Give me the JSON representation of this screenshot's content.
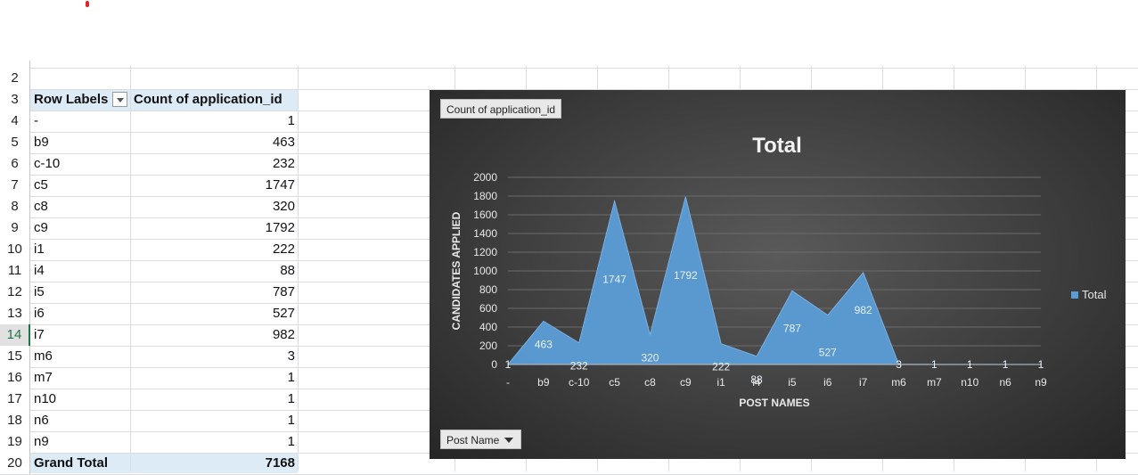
{
  "pivot": {
    "header_row_labels": "Row Labels",
    "header_count": "Count of application_id",
    "rows": [
      {
        "label": "-",
        "value": "1"
      },
      {
        "label": "b9",
        "value": "463"
      },
      {
        "label": "c-10",
        "value": "232"
      },
      {
        "label": "c5",
        "value": "1747"
      },
      {
        "label": "c8",
        "value": "320"
      },
      {
        "label": "c9",
        "value": "1792"
      },
      {
        "label": "i1",
        "value": "222"
      },
      {
        "label": "i4",
        "value": "88"
      },
      {
        "label": "i5",
        "value": "787"
      },
      {
        "label": "i6",
        "value": "527"
      },
      {
        "label": "i7",
        "value": "982"
      },
      {
        "label": "m6",
        "value": "3"
      },
      {
        "label": "m7",
        "value": "1"
      },
      {
        "label": "n10",
        "value": "1"
      },
      {
        "label": "n6",
        "value": "1"
      },
      {
        "label": "n9",
        "value": "1"
      }
    ],
    "grand_total_label": "Grand Total",
    "grand_total_value": "7168"
  },
  "row_numbers": [
    "2",
    "3",
    "4",
    "5",
    "6",
    "7",
    "8",
    "9",
    "10",
    "11",
    "12",
    "13",
    "14",
    "15",
    "16",
    "17",
    "18",
    "19",
    "20"
  ],
  "active_row": "14",
  "chart": {
    "value_field_button": "Count of application_id",
    "axis_field_button": "Post Name",
    "legend_label": "Total"
  },
  "chart_data": {
    "type": "area",
    "title": "Total",
    "xlabel": "POST NAMES",
    "ylabel": "CANDIDATES APPLIED",
    "categories": [
      "-",
      "b9",
      "c-10",
      "c5",
      "c8",
      "c9",
      "i1",
      "i4",
      "i5",
      "i6",
      "i7",
      "m6",
      "m7",
      "n10",
      "n6",
      "n9"
    ],
    "series": [
      {
        "name": "Total",
        "values": [
          1,
          463,
          232,
          1747,
          320,
          1792,
          222,
          88,
          787,
          527,
          982,
          3,
          1,
          1,
          1,
          1
        ]
      }
    ],
    "ylim": [
      0,
      2000
    ],
    "yticks": [
      0,
      200,
      400,
      600,
      800,
      1000,
      1200,
      1400,
      1600,
      1800,
      2000
    ],
    "grid": true,
    "legend": "right",
    "color": "#5b9bd5"
  }
}
